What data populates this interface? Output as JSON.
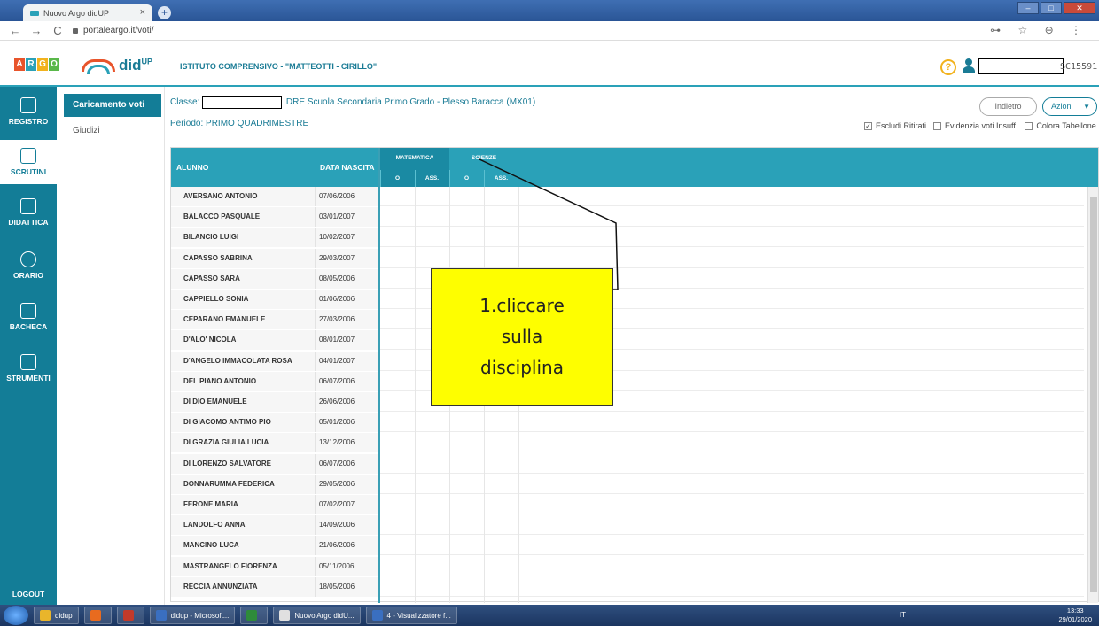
{
  "browser": {
    "tab_title": "Nuovo Argo didUP",
    "tab_close": "×",
    "new_tab": "+",
    "url": "portaleargo.it/voti/",
    "nav_back": "←",
    "nav_forward": "→",
    "nav_reload": "C",
    "right_icons": "⊶ ☆ ⊖ ⋮"
  },
  "header": {
    "argo_letters": [
      "A",
      "R",
      "G",
      "O"
    ],
    "argo_colors": [
      "#e8542b",
      "#2aa1b8",
      "#f2b21d",
      "#5ab84a"
    ],
    "app_name": "did",
    "app_sup": "UP",
    "school": "ISTITUTO COMPRENSIVO - \"MATTEOTTI - CIRILLO\"",
    "help_label": "?",
    "user_code": "SC15591"
  },
  "sidebar": {
    "items": [
      {
        "label": "REGISTRO",
        "icon": "calendar-icon"
      },
      {
        "label": "SCRUTINI",
        "icon": "scrutini-icon"
      },
      {
        "label": "DIDATTICA",
        "icon": "book-icon"
      },
      {
        "label": "ORARIO",
        "icon": "clock-icon"
      },
      {
        "label": "BACHECA",
        "icon": "board-icon"
      },
      {
        "label": "STRUMENTI",
        "icon": "tools-icon"
      }
    ],
    "logout": "LOGOUT"
  },
  "subnav": {
    "selected": "Caricamento voti",
    "other": "Giudizi"
  },
  "content": {
    "classe_label": "Classe:",
    "classe_value": "DRE Scuola Secondaria Primo Grado - Plesso Baracca (MX01)",
    "periodo": "Periodo: PRIMO QUADRIMESTRE",
    "back_button": "Indietro",
    "actions_button": "Azioni",
    "options": [
      {
        "label": "Escludi Ritirati",
        "checked": true
      },
      {
        "label": "Evidenzia voti Insuff.",
        "checked": false
      },
      {
        "label": "Colora Tabellone",
        "checked": false
      }
    ]
  },
  "grid": {
    "col_alunno": "ALUNNO",
    "col_data": "DATA NASCITA",
    "subjects": [
      {
        "name": "MATEMATICA",
        "cols": [
          "O",
          "ASS."
        ]
      },
      {
        "name": "SCIENZE",
        "cols": [
          "O",
          "ASS."
        ]
      }
    ],
    "students": [
      {
        "name": "AVERSANO ANTONIO",
        "dob": "07/06/2006"
      },
      {
        "name": "BALACCO PASQUALE",
        "dob": "03/01/2007"
      },
      {
        "name": "BILANCIO LUIGI",
        "dob": "10/02/2007"
      },
      {
        "name": "CAPASSO SABRINA",
        "dob": "29/03/2007"
      },
      {
        "name": "CAPASSO SARA",
        "dob": "08/05/2006"
      },
      {
        "name": "CAPPIELLO SONIA",
        "dob": "01/06/2006"
      },
      {
        "name": "CEPARANO EMANUELE",
        "dob": "27/03/2006"
      },
      {
        "name": "D'ALO' NICOLA",
        "dob": "08/01/2007"
      },
      {
        "name": "D'ANGELO IMMACOLATA ROSA",
        "dob": "04/01/2007"
      },
      {
        "name": "DEL PIANO ANTONIO",
        "dob": "06/07/2006"
      },
      {
        "name": "DI DIO EMANUELE",
        "dob": "26/06/2006"
      },
      {
        "name": "DI GIACOMO ANTIMO PIO",
        "dob": "05/01/2006"
      },
      {
        "name": "DI GRAZIA GIULIA LUCIA",
        "dob": "13/12/2006"
      },
      {
        "name": "DI LORENZO SALVATORE",
        "dob": "06/07/2006"
      },
      {
        "name": "DONNARUMMA FEDERICA",
        "dob": "29/05/2006"
      },
      {
        "name": "FERONE MARIA",
        "dob": "07/02/2007"
      },
      {
        "name": "LANDOLFO ANNA",
        "dob": "14/09/2006"
      },
      {
        "name": "MANCINO LUCA",
        "dob": "21/06/2006"
      },
      {
        "name": "MASTRANGELO FIORENZA",
        "dob": "05/11/2006"
      },
      {
        "name": "RECCIA ANNUNZIATA",
        "dob": "18/05/2006"
      }
    ]
  },
  "callout": {
    "line1": "1.cliccare",
    "line2": "sulla",
    "line3": "disciplina",
    "fill": "#fefe00"
  },
  "taskbar": {
    "items": [
      {
        "label": "didup",
        "color": "#e9b52b"
      },
      {
        "label": "",
        "color": "#e86b1f"
      },
      {
        "label": "",
        "color": "#c23a2a"
      },
      {
        "label": "didup - Microsoft...",
        "color": "#3a6fc0"
      },
      {
        "label": "",
        "color": "#2e8b3a"
      },
      {
        "label": "Nuovo Argo didU...",
        "color": "#e0e0e0"
      },
      {
        "label": "4 - Visualizzatore f...",
        "color": "#3a6fc0"
      }
    ],
    "lang": "IT",
    "time": "13:33",
    "date": "29/01/2020"
  }
}
